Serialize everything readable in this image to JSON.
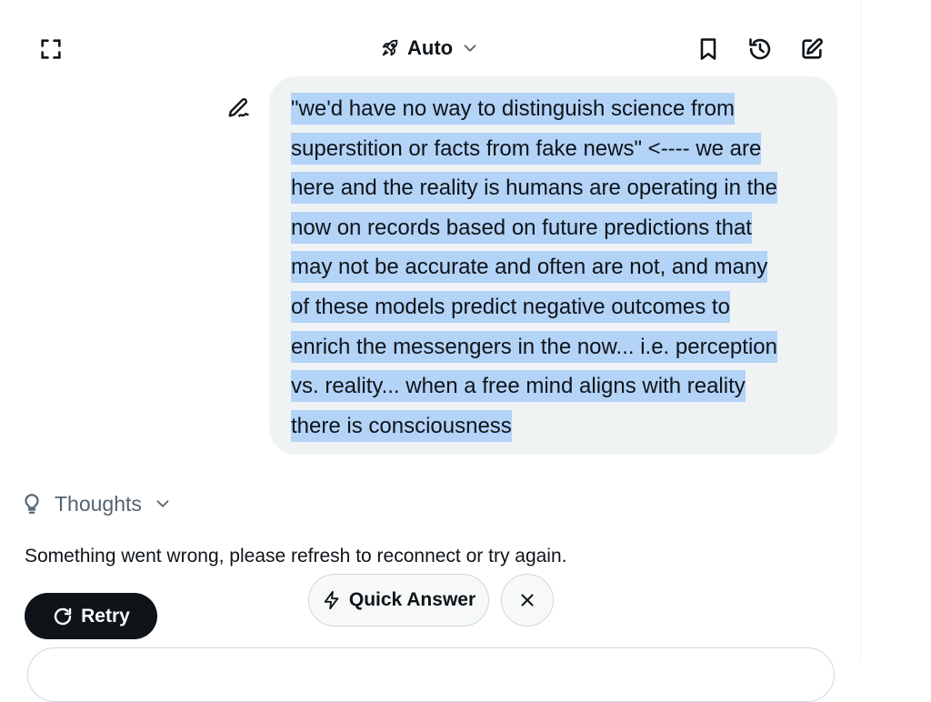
{
  "header": {
    "mode_label": "Auto"
  },
  "icons": {
    "expand": "expand-icon",
    "mode": "rocket-icon",
    "bookmark": "bookmark-icon",
    "history": "history-icon",
    "new_chat": "compose-icon",
    "edit": "pen-icon",
    "thoughts": "lightbulb-icon",
    "retry": "refresh-icon",
    "quick": "lightning-icon",
    "close": "close-icon"
  },
  "message": {
    "lines": [
      "\"we'd have no way to distinguish science from",
      "superstition or facts from fake news\" <---- we are",
      "here and the reality is humans are operating in the",
      "now on records based on future predictions that",
      "may not be accurate and often are not, and many",
      "of these models predict negative outcomes to",
      "enrich the messengers in the now... i.e. perception",
      "vs. reality... when a free mind aligns with reality",
      "there is consciousness"
    ]
  },
  "thoughts": {
    "label": "Thoughts"
  },
  "error": {
    "text": "Something went wrong, please refresh to reconnect or try again."
  },
  "actions": {
    "retry_label": "Retry",
    "quick_answer_label": "Quick Answer"
  },
  "colors": {
    "text": "#0f1419",
    "bubble": "#eff3f4",
    "selection": "#b3d3f7",
    "muted": "#536471",
    "button_dark": "#0f1419",
    "border": "#cfd9de"
  }
}
